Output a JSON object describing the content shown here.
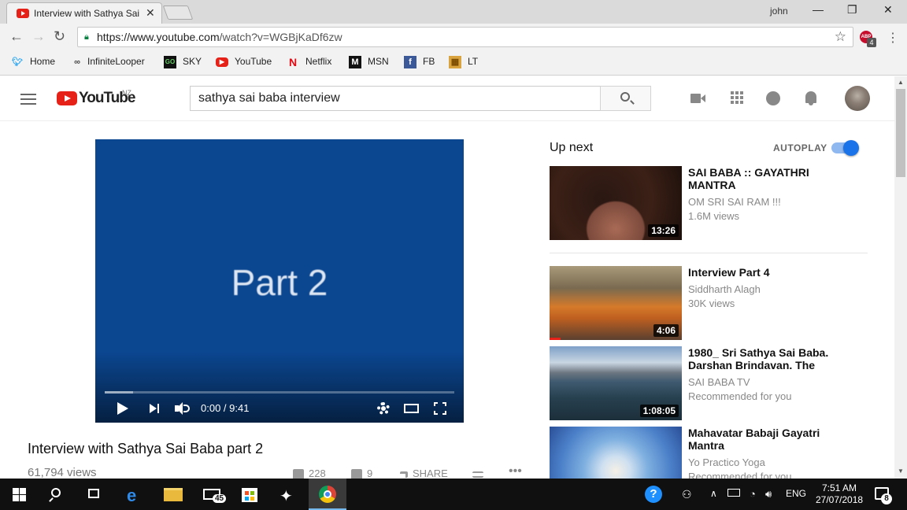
{
  "browser": {
    "tab_title": "Interview with Sathya Sai",
    "tab_close": "✕",
    "user": "john",
    "min_label": "—",
    "max_label": "❐",
    "close_label": "✕",
    "url_host": "https://www.youtube.com",
    "url_path": "/watch?v=WGBjKaDf6zw",
    "extension_badge": "4",
    "extension_label": "ABP"
  },
  "bookmarks": [
    {
      "label": "Home",
      "icon": "twitter-icon"
    },
    {
      "label": "InfiniteLooper",
      "icon": "infinity-icon"
    },
    {
      "label": "SKY",
      "icon": "sky-go-icon"
    },
    {
      "label": "YouTube",
      "icon": "youtube-icon"
    },
    {
      "label": "Netflix",
      "icon": "netflix-icon"
    },
    {
      "label": "MSN",
      "icon": "msn-icon"
    },
    {
      "label": "FB",
      "icon": "facebook-icon"
    },
    {
      "label": "LT",
      "icon": "lt-icon"
    }
  ],
  "youtube": {
    "logo_text": "YouTube",
    "country": "NZ",
    "search_value": "sathya sai baba interview"
  },
  "player": {
    "slide_text": "Part 2",
    "time": "0:00 / 9:41",
    "loaded_fraction": 0.08
  },
  "video": {
    "title": "Interview with Sathya Sai Baba part 2",
    "views": "61,794 views",
    "likes": "228",
    "dislikes": "9",
    "share": "SHARE"
  },
  "sidebar": {
    "up_next": "Up next",
    "autoplay": "AUTOPLAY",
    "autoplay_on": true,
    "items": [
      {
        "title": "SAI BABA :: GAYATHRI MANTRA",
        "channel": "OM SRI SAI RAM !!!",
        "meta": "1.6M views",
        "duration": "13:26"
      },
      {
        "title": "Interview Part 4",
        "channel": "Siddharth Alagh",
        "meta": "30K views",
        "duration": "4:06"
      },
      {
        "title": "1980_ Sri Sathya Sai Baba. Darshan Brindavan. The Early…",
        "channel": "SAI BABA TV",
        "meta": "Recommended for you",
        "duration": "1:08:05"
      },
      {
        "title": "Mahavatar Babaji Gayatri Mantra",
        "channel": "Yo Practico Yoga",
        "meta": "Recommended for you",
        "duration": ""
      }
    ]
  },
  "taskbar": {
    "mail_badge": "45",
    "language": "ENG",
    "time": "7:51 AM",
    "date": "27/07/2018",
    "notifications": "8"
  },
  "colors": {
    "player_bg": "#0b4690",
    "youtube_red": "#e62117",
    "autoplay_blue": "#1a73e8",
    "taskbar": "#101010"
  }
}
